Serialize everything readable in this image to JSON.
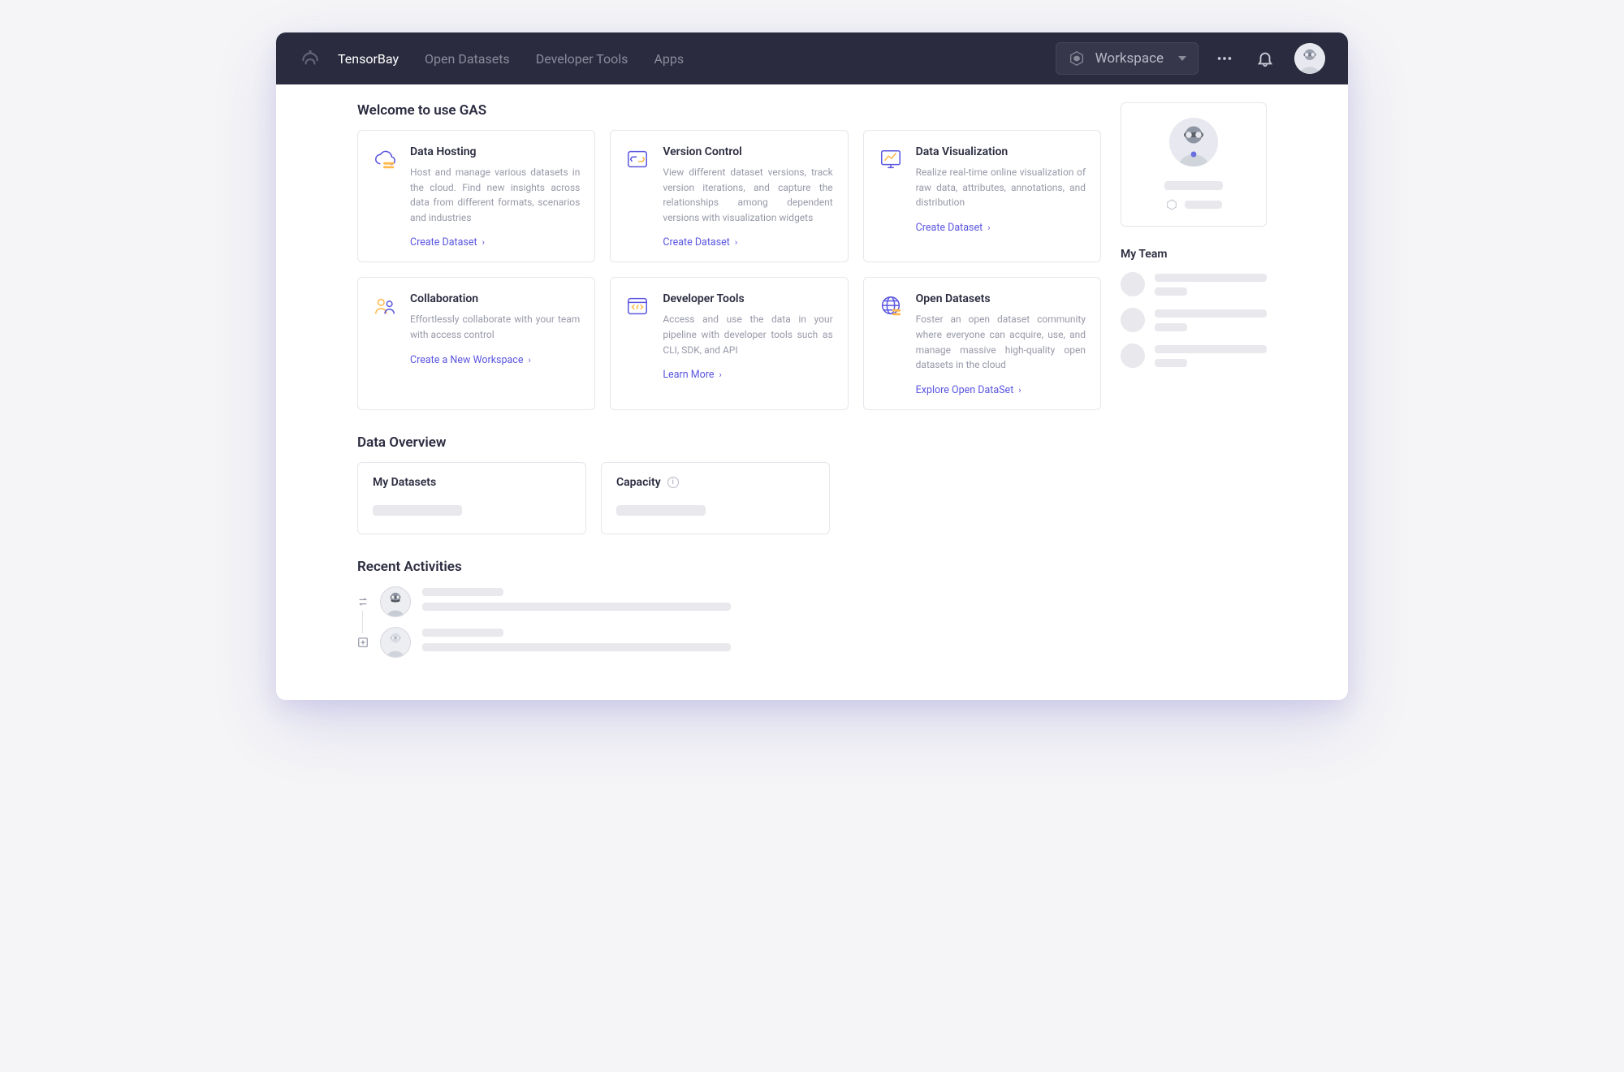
{
  "header": {
    "nav": [
      {
        "label": "TensorBay",
        "active": true
      },
      {
        "label": "Open Datasets",
        "active": false
      },
      {
        "label": "Developer Tools",
        "active": false
      },
      {
        "label": "Apps",
        "active": false
      }
    ],
    "workspace_label": "Workspace"
  },
  "welcome": {
    "title": "Welcome to use GAS",
    "cards": [
      {
        "title": "Data Hosting",
        "desc": "Host and manage various datasets in the cloud. Find new insights across data from different formats, scenarios and industries",
        "link": "Create Dataset",
        "icon": "cloud"
      },
      {
        "title": "Version Control",
        "desc": "View different dataset versions, track version iterations, and capture the relationships among dependent versions with visualization widgets",
        "link": "Create Dataset",
        "icon": "version"
      },
      {
        "title": "Data Visualization",
        "desc": "Realize real-time online visualization of raw data, attributes, annotations, and distribution",
        "link": "Create Dataset",
        "icon": "chart"
      },
      {
        "title": "Collaboration",
        "desc": "Effortlessly collaborate with your team with access control",
        "link": "Create a New  Workspace",
        "icon": "people"
      },
      {
        "title": "Developer Tools",
        "desc": "Access and use the data in your pipeline with developer tools such as CLI, SDK, and API",
        "link": "Learn More",
        "icon": "code"
      },
      {
        "title": "Open Datasets",
        "desc": "Foster an open dataset community where everyone can acquire, use, and manage massive high-quality open datasets in the cloud",
        "link": "Explore Open DataSet",
        "icon": "globe"
      }
    ]
  },
  "data_overview": {
    "title": "Data Overview",
    "my_datasets": "My Datasets",
    "capacity": "Capacity"
  },
  "recent": {
    "title": "Recent Activities"
  },
  "side": {
    "my_team": "My Team"
  }
}
